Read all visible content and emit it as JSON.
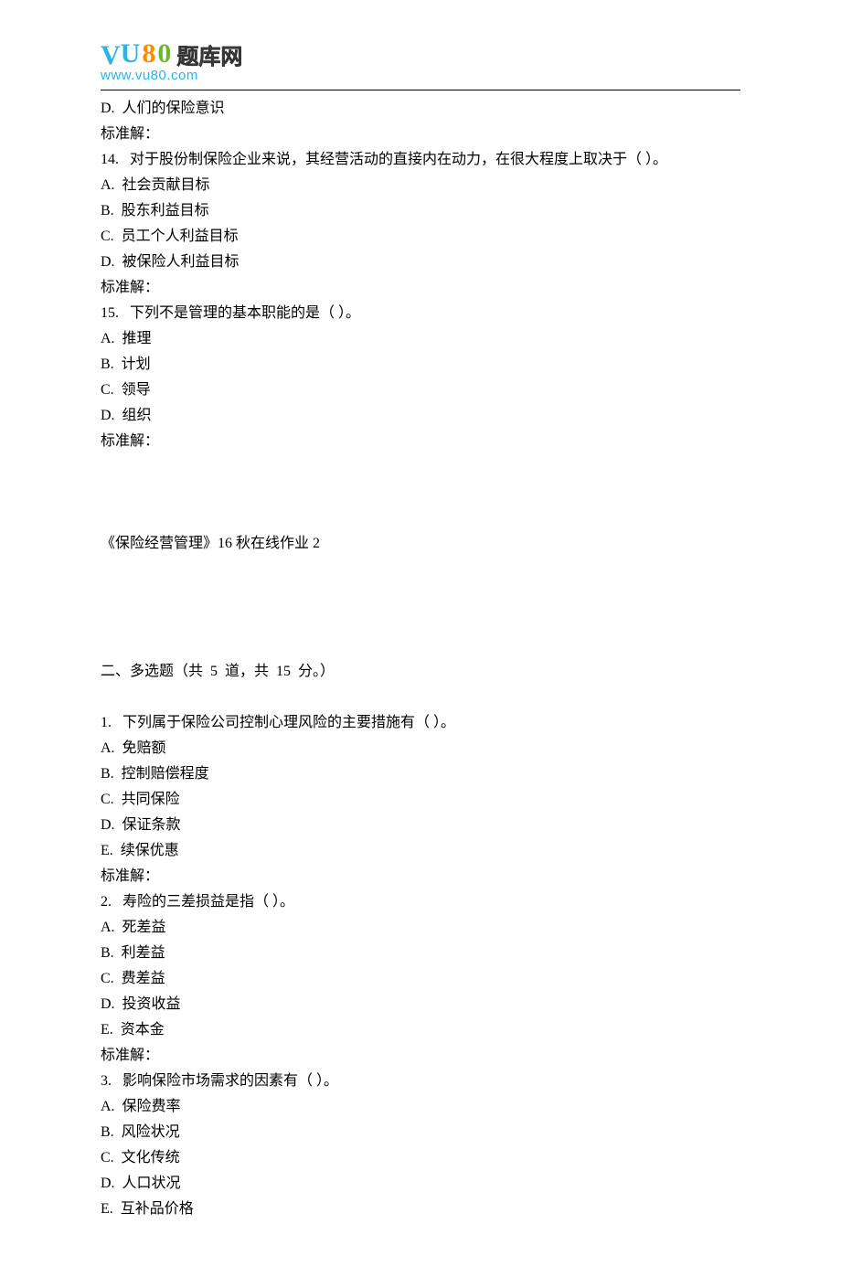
{
  "logo": {
    "cn_text": "题库网",
    "url": "www.vu80.com"
  },
  "lines_top": [
    "D.  人们的保险意识",
    "标准解：",
    "14.   对于股份制保险企业来说，其经营活动的直接内在动力，在很大程度上取决于（ ）。",
    "A.  社会贡献目标",
    "B.  股东利益目标",
    "C.  员工个人利益目标",
    "D.  被保险人利益目标",
    "标准解：",
    "15.   下列不是管理的基本职能的是（ ）。",
    "A.  推理",
    "B.  计划",
    "C.  领导",
    "D.  组织",
    "标准解："
  ],
  "section_title": "《保险经营管理》16 秋在线作业 2",
  "section_header": "二、多选题（共  5  道，共  15  分。）",
  "lines_multi": [
    "1.   下列属于保险公司控制心理风险的主要措施有（ ）。",
    "A.  免赔额",
    "B.  控制赔偿程度",
    "C.  共同保险",
    "D.  保证条款",
    "E.  续保优惠",
    "标准解：",
    "2.   寿险的三差损益是指（ ）。",
    "A.  死差益",
    "B.  利差益",
    "C.  费差益",
    "D.  投资收益",
    "E.  资本金",
    "标准解：",
    "3.   影响保险市场需求的因素有（ ）。",
    "A.  保险费率",
    "B.  风险状况",
    "C.  文化传统",
    "D.  人口状况",
    "E.  互补品价格"
  ]
}
